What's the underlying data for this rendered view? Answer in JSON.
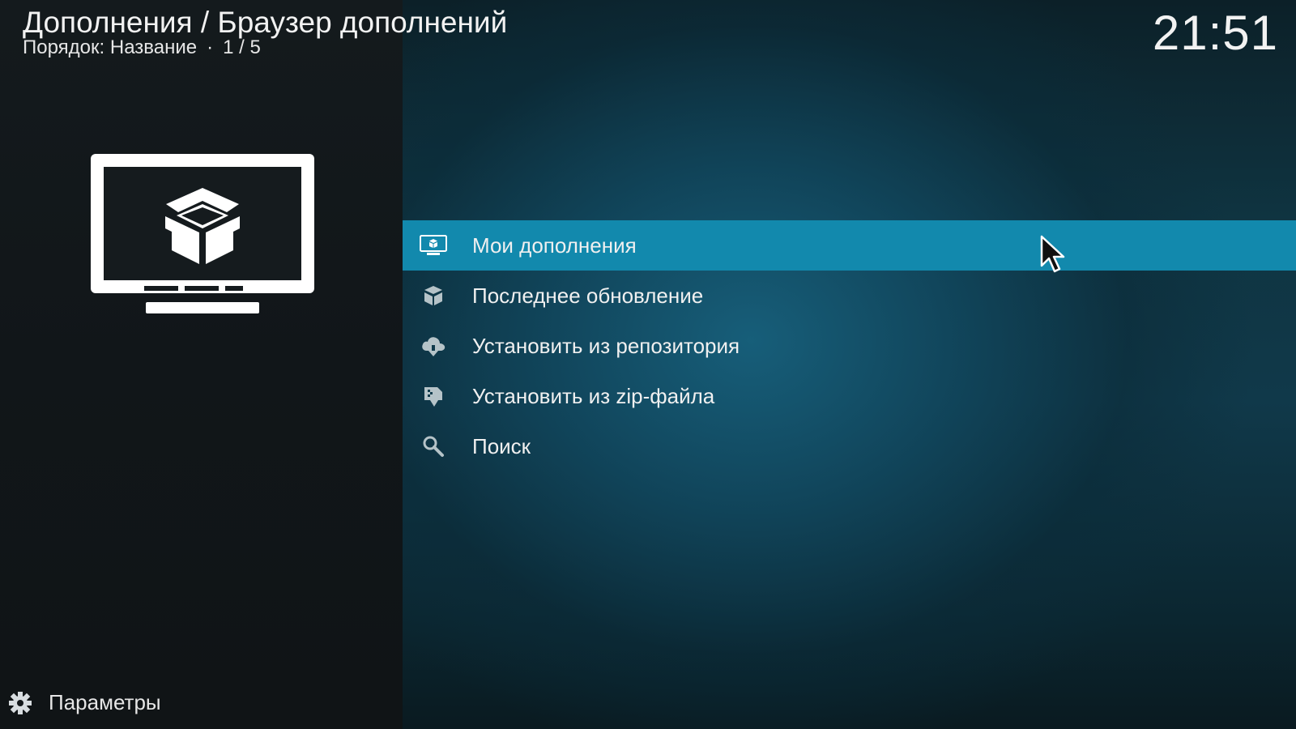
{
  "header": {
    "breadcrumb": "Дополнения / Браузер дополнений",
    "sort_label": "Порядок: Название",
    "sort_separator": "·",
    "position": "1 / 5"
  },
  "clock": "21:51",
  "preview_icon": "tv-addon-box-icon",
  "menu": {
    "items": [
      {
        "label": "Мои дополнения",
        "icon": "tv-box-icon",
        "selected": true
      },
      {
        "label": "Последнее обновление",
        "icon": "box-stack-icon",
        "selected": false
      },
      {
        "label": "Установить из репозитория",
        "icon": "cloud-download-icon",
        "selected": false
      },
      {
        "label": "Установить из zip-файла",
        "icon": "zip-download-icon",
        "selected": false
      },
      {
        "label": "Поиск",
        "icon": "search-icon",
        "selected": false
      }
    ]
  },
  "settings": {
    "label": "Параметры",
    "icon": "gear-icon"
  },
  "colors": {
    "accent": "#1289ad",
    "left_panel": "#121719",
    "right_panel": "#10394a"
  }
}
